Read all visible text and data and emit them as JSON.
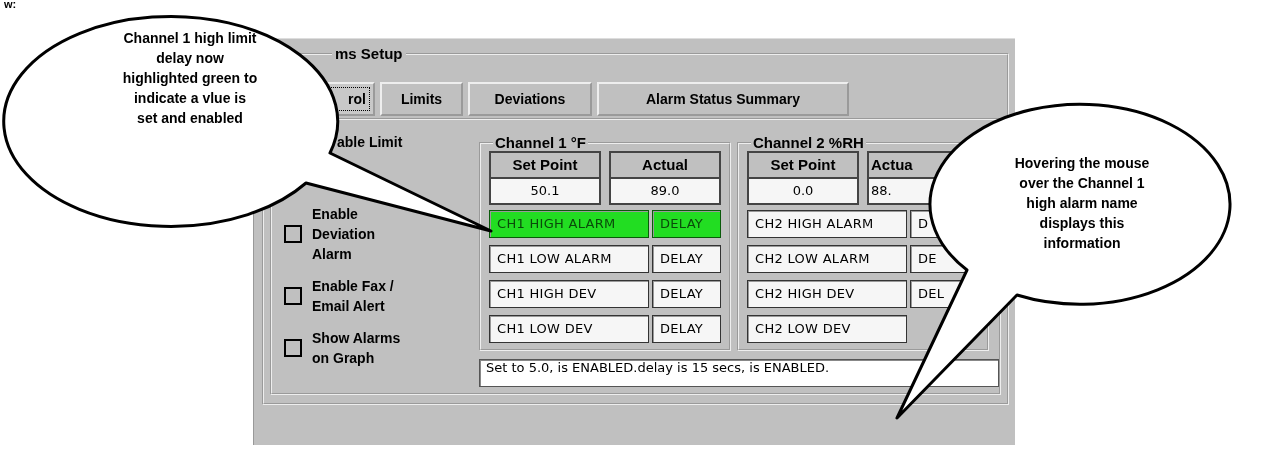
{
  "page_fragment": "w:",
  "window": {
    "group_title": "ms Setup",
    "tabs": [
      {
        "label": "rol",
        "selected": true
      },
      {
        "label": "Limits",
        "selected": false
      },
      {
        "label": "Deviations",
        "selected": false
      },
      {
        "label": "Alarm Status Summary",
        "selected": false
      }
    ],
    "partial_label": "able Limit",
    "checkboxes": [
      {
        "label": "Enable Deviation Alarm",
        "checked": false
      },
      {
        "label": "Enable Fax / Email Alert",
        "checked": false
      },
      {
        "label": "Show Alarms on Graph",
        "checked": false
      }
    ],
    "channels": [
      {
        "title": "Channel 1 °F",
        "set_point_label": "Set Point",
        "set_point": "50.1",
        "actual_label": "Actual",
        "actual": "89.0",
        "rows": [
          {
            "name": "CH1 HIGH ALARM",
            "delay": "DELAY",
            "highlighted": true
          },
          {
            "name": "CH1 LOW ALARM",
            "delay": "DELAY",
            "highlighted": false
          },
          {
            "name": "CH1 HIGH DEV",
            "delay": "DELAY",
            "highlighted": false
          },
          {
            "name": "CH1 LOW DEV",
            "delay": "DELAY",
            "highlighted": false
          }
        ]
      },
      {
        "title": "Channel 2 %RH",
        "set_point_label": "Set Point",
        "set_point": "0.0",
        "actual_label": "Actua",
        "actual": "88.",
        "rows": [
          {
            "name": "CH2 HIGH ALARM",
            "delay": "D",
            "highlighted": false
          },
          {
            "name": "CH2 LOW ALARM",
            "delay": "DE",
            "highlighted": false
          },
          {
            "name": "CH2 HIGH DEV",
            "delay": "DEL",
            "highlighted": false
          },
          {
            "name": "CH2 LOW DEV",
            "highlighted": false
          }
        ]
      }
    ],
    "status_text": "Set to 5.0, is ENABLED.delay is 15 secs, is ENABLED."
  },
  "callouts": [
    {
      "text": "Channel 1 high limit\ndelay now\nhighlighted green to\nindicate a vlue is\nset and enabled"
    },
    {
      "text": "Hovering the mouse\nover the Channel 1\nhigh alarm name\ndisplays this\ninformation"
    }
  ]
}
